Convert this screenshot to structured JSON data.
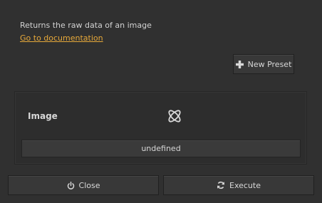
{
  "description": "Returns the raw data of an image",
  "documentation_link": "Go to documentation",
  "toolbar": {
    "new_preset_label": "New Preset",
    "new_preset_icon": "plus-icon"
  },
  "parameter": {
    "label": "Image",
    "icon": "node-link-icon",
    "value": "undefined"
  },
  "footer": {
    "close_label": "Close",
    "close_icon": "power-icon",
    "execute_label": "Execute",
    "execute_icon": "refresh-icon"
  },
  "colors": {
    "background": "#303030",
    "link": "#e7a93a",
    "text": "#d6d6d6"
  }
}
